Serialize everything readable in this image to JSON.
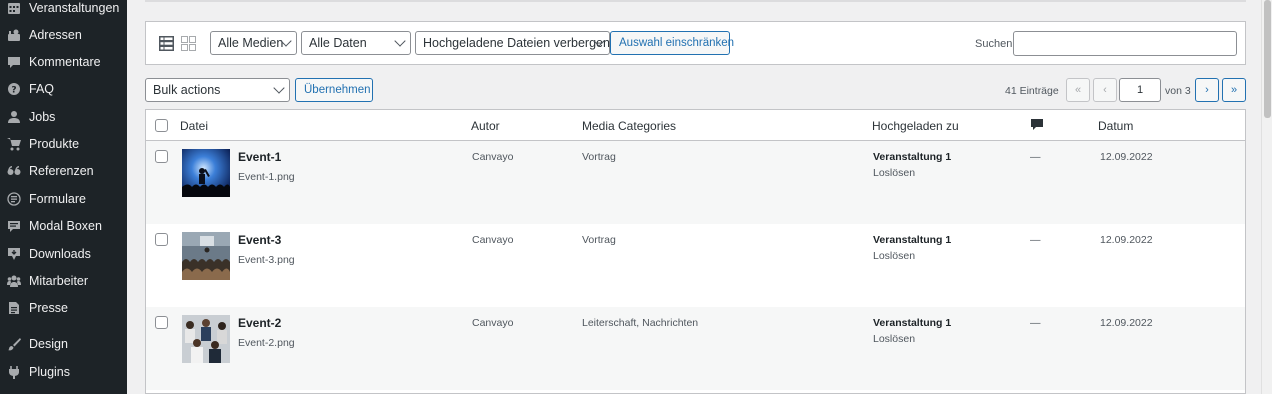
{
  "sidebar": {
    "items": [
      {
        "label": "Veranstaltungen",
        "icon": "calendar-icon"
      },
      {
        "label": "Adressen",
        "icon": "address-icon"
      },
      {
        "label": "Kommentare",
        "icon": "comment-icon"
      },
      {
        "label": "FAQ",
        "icon": "help-icon"
      },
      {
        "label": "Jobs",
        "icon": "users-icon"
      },
      {
        "label": "Produkte",
        "icon": "cart-icon"
      },
      {
        "label": "Referenzen",
        "icon": "quote-icon"
      },
      {
        "label": "Formulare",
        "icon": "form-icon"
      },
      {
        "label": "Modal Boxen",
        "icon": "modal-icon"
      },
      {
        "label": "Downloads",
        "icon": "download-icon"
      },
      {
        "label": "Mitarbeiter",
        "icon": "groups-icon"
      },
      {
        "label": "Presse",
        "icon": "document-icon"
      },
      {
        "label": "Design",
        "icon": "brush-icon"
      },
      {
        "label": "Plugins",
        "icon": "plugin-icon"
      }
    ]
  },
  "filters": {
    "media_type": "Alle Medien",
    "dates": "Alle Daten",
    "uploaded": "Hochgeladene Dateien verbergen",
    "restrict_button": "Auswahl einschränken",
    "search_label": "Suchen",
    "search_value": ""
  },
  "bulk": {
    "select": "Bulk actions",
    "apply_button": "Übernehmen"
  },
  "pagination": {
    "count": "41 Einträge",
    "first": "«",
    "prev": "‹",
    "current_page": "1",
    "of_label": "von 3",
    "next": "›",
    "last": "»"
  },
  "table": {
    "columns": {
      "file": "Datei",
      "author": "Autor",
      "categories": "Media Categories",
      "uploaded_to": "Hochgeladen zu",
      "comments_icon": "comment-icon",
      "date": "Datum"
    },
    "rows": [
      {
        "title": "Event-1",
        "filename": "Event-1.png",
        "author": "Canvayo",
        "categories": "Vortrag",
        "uploaded_to": "Veranstaltung 1",
        "detach": "Loslösen",
        "comments": "—",
        "date": "12.09.2022"
      },
      {
        "title": "Event-3",
        "filename": "Event-3.png",
        "author": "Canvayo",
        "categories": "Vortrag",
        "uploaded_to": "Veranstaltung 1",
        "detach": "Loslösen",
        "comments": "—",
        "date": "12.09.2022"
      },
      {
        "title": "Event-2",
        "filename": "Event-2.png",
        "author": "Canvayo",
        "categories": "Leiterschaft, Nachrichten",
        "uploaded_to": "Veranstaltung 1",
        "detach": "Loslösen",
        "comments": "—",
        "date": "12.09.2022"
      }
    ]
  }
}
